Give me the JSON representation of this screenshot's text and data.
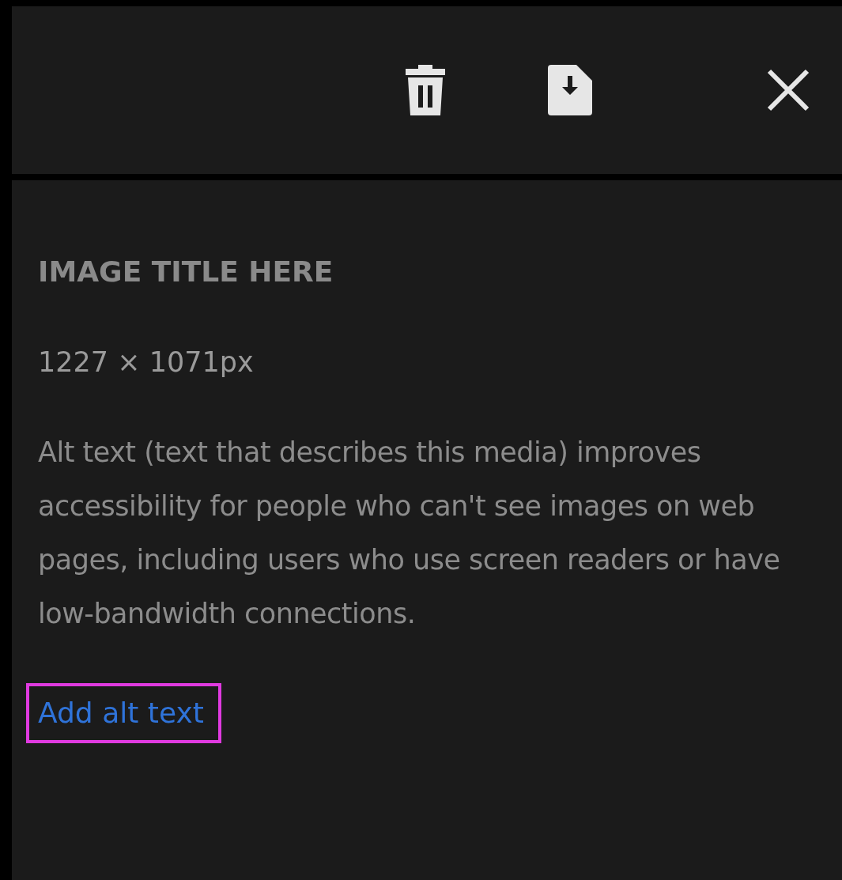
{
  "toolbar": {
    "buttons": [
      {
        "kind": "delete"
      },
      {
        "kind": "download"
      },
      {
        "kind": "close"
      }
    ]
  },
  "details": {
    "title": "IMAGE TITLE HERE",
    "dimensions": "1227 × 1071px",
    "description": "Alt text (text that describes this media) improves accessibility for people who can't see images on web pages, including users who use screen readers or have low-bandwidth connections.",
    "link": {
      "label": "Add alt text",
      "focused": true
    }
  }
}
